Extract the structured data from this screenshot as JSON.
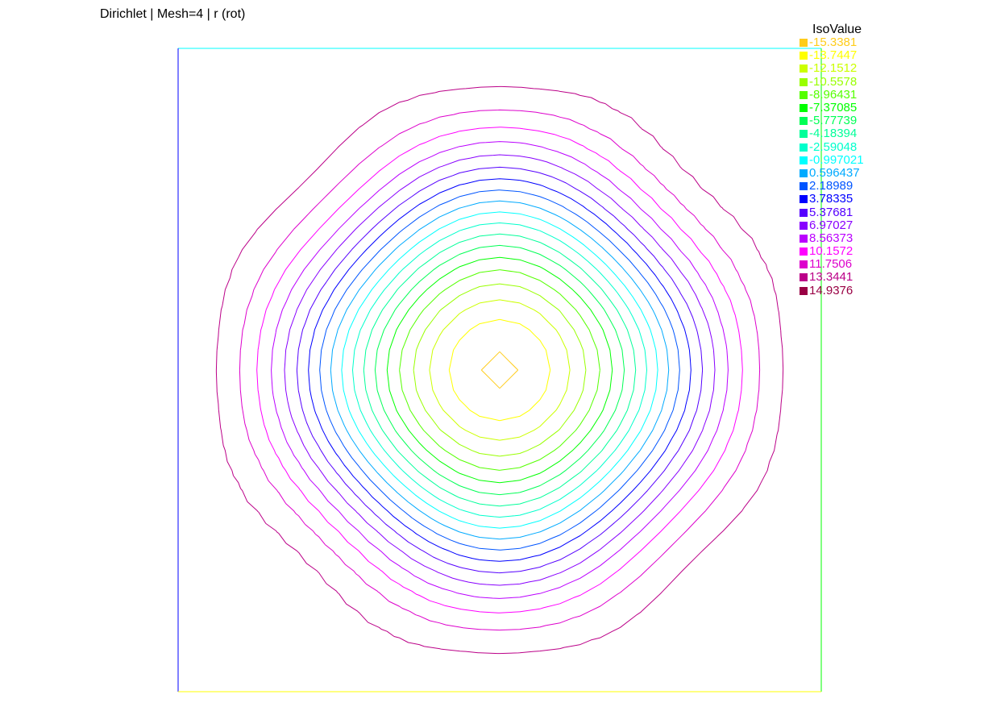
{
  "title": "Dirichlet | Mesh=4 | r (rot)",
  "chart_data": {
    "type": "contour",
    "title": "Dirichlet | Mesh=4 | r (rot)",
    "legend_title": "IsoValue",
    "legend_placement": "top-right",
    "levels": [
      {
        "value": "-15.3381",
        "color": "#ffcc1a"
      },
      {
        "value": "-13.7447",
        "color": "#ffff00"
      },
      {
        "value": "-12.1512",
        "color": "#ccff00"
      },
      {
        "value": "-10.5578",
        "color": "#99ff00"
      },
      {
        "value": "-8.96431",
        "color": "#55ff00"
      },
      {
        "value": "-7.37085",
        "color": "#00ff00"
      },
      {
        "value": "-5.77739",
        "color": "#00ff55"
      },
      {
        "value": "-4.18394",
        "color": "#00ff99"
      },
      {
        "value": "-2.59048",
        "color": "#00ffcc"
      },
      {
        "value": "-0.997021",
        "color": "#00ffff"
      },
      {
        "value": "0.596437",
        "color": "#00aaff"
      },
      {
        "value": "2.18989",
        "color": "#0055ff"
      },
      {
        "value": "3.78335",
        "color": "#0000ff"
      },
      {
        "value": "5.37681",
        "color": "#5500ff"
      },
      {
        "value": "6.97027",
        "color": "#8800ff"
      },
      {
        "value": "8.56373",
        "color": "#bb00ff"
      },
      {
        "value": "10.1572",
        "color": "#ff00ff"
      },
      {
        "value": "11.7506",
        "color": "#dd00cc"
      },
      {
        "value": "13.3441",
        "color": "#bb0088"
      },
      {
        "value": "14.9376",
        "color": "#990044"
      }
    ]
  }
}
